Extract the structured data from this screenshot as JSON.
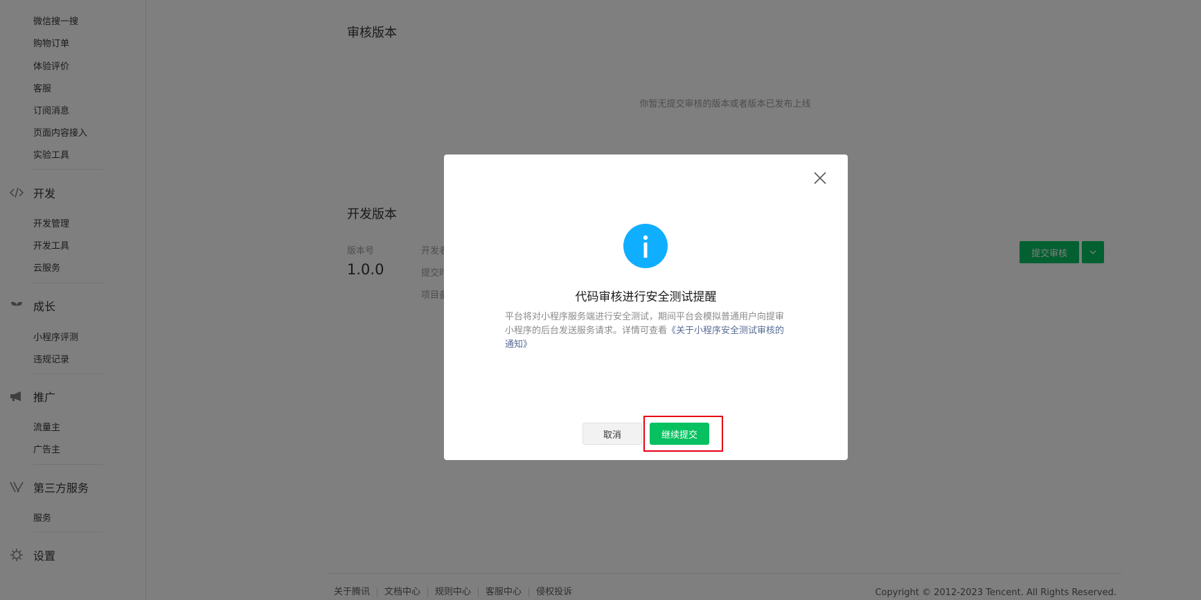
{
  "sidebar": {
    "top_items": [
      "微信搜一搜",
      "购物订单",
      "体验评价",
      "客服",
      "订阅消息",
      "页面内容接入",
      "实验工具"
    ],
    "sections": [
      {
        "label": "开发",
        "icon": "code-icon",
        "items": [
          "开发管理",
          "开发工具",
          "云服务"
        ]
      },
      {
        "label": "成长",
        "icon": "sprout-icon",
        "items": [
          "小程序评测",
          "违规记录"
        ]
      },
      {
        "label": "推广",
        "icon": "megaphone-icon",
        "items": [
          "流量主",
          "广告主"
        ]
      },
      {
        "label": "第三方服务",
        "icon": "third-party-icon",
        "items": [
          "服务"
        ]
      },
      {
        "label": "设置",
        "icon": "gear-icon",
        "items": []
      }
    ]
  },
  "review_panel": {
    "title": "审核版本",
    "empty_message": "你暂无提交审核的版本或者版本已发布上线"
  },
  "dev_panel": {
    "title": "开发版本",
    "version_label": "版本号",
    "version_value": "1.0.0",
    "meta_labels": [
      "开发者",
      "提交时",
      "项目备"
    ],
    "submit_label": "提交审核",
    "dropdown_icon": "chevron-down-icon"
  },
  "footer": {
    "links": [
      "关于腾讯",
      "文档中心",
      "规则中心",
      "客服中心",
      "侵权投诉"
    ],
    "copyright": "Copyright © 2012-2023 Tencent. All Rights Reserved."
  },
  "dialog": {
    "title": "代码审核进行安全测试提醒",
    "body_text": "平台将对小程序服务端进行安全测试，期间平台会模拟普通用户向提审小程序的后台发送服务请求。详情可查看",
    "body_link": "《关于小程序安全测试审核的通知》",
    "cancel_label": "取消",
    "continue_label": "继续提交",
    "icon": "info-icon",
    "close_icon": "close-icon"
  },
  "colors": {
    "accent_green": "#07c160",
    "info_blue": "#10aeff",
    "highlight_red": "#e60012",
    "link_blue": "#576b95"
  }
}
